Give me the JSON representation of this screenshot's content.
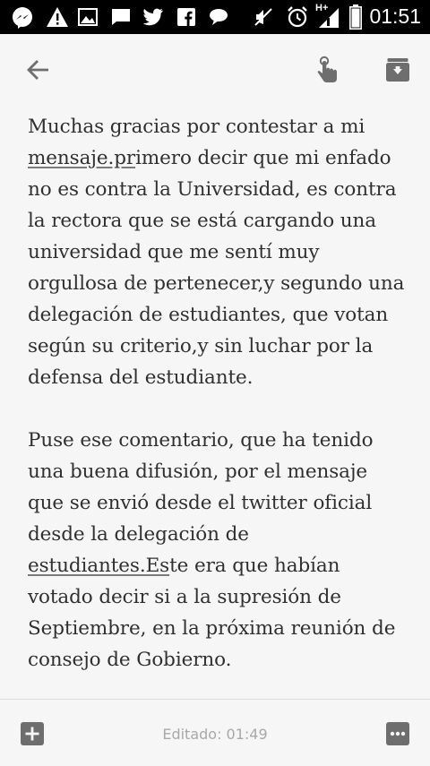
{
  "status_bar": {
    "time": "01:51",
    "network": "H+",
    "icons": [
      "messenger-icon",
      "warning-icon",
      "gallery-icon",
      "message-icon",
      "twitter-icon",
      "facebook-icon",
      "chat-icon",
      "mute-icon",
      "alarm-icon",
      "signal-icon",
      "battery-icon"
    ]
  },
  "toolbar": {
    "back_icon": "arrow-left-icon",
    "pin_icon": "touch-hand-icon",
    "archive_icon": "archive-icon"
  },
  "note": {
    "p1_before_link": "Muchas gracias por contestar a mi ",
    "p1_link": "mensaje.pr",
    "p1_after_link": "imero decir que mi enfado no es contra la Universidad, es contra la rectora que se está cargando una universidad que me sentí muy orgullosa de pertenecer,y segundo una delegación de estudiantes, que votan según su criterio,y sin luchar por la defensa del estudiante.",
    "p2_before_link": "Puse ese comentario, que ha tenido una buena difusión, por el mensaje que se envió desde el twitter oficial desde la delegación de ",
    "p2_link": "estudiantes.Es",
    "p2_after_link": "te era que habían votado decir si a la supresión de Septiembre, en la próxima reunión de consejo de Gobierno."
  },
  "bottom_bar": {
    "edited_label": "Editado: 01:49",
    "add_icon": "add-box-icon",
    "more_icon": "more-horizontal-icon"
  }
}
